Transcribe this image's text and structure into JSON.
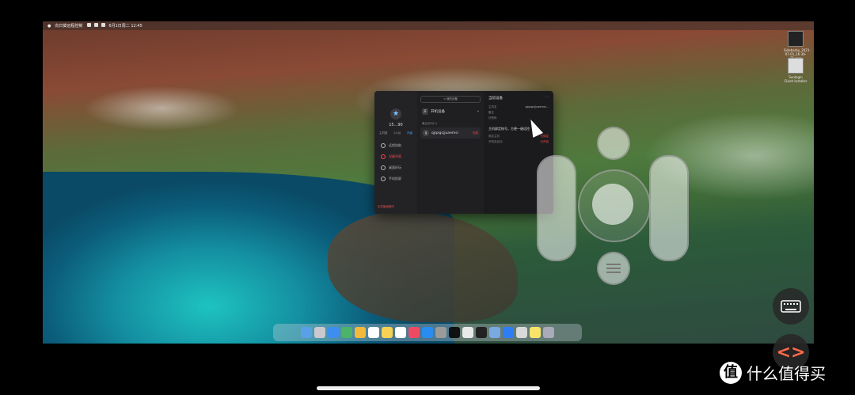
{
  "menubar": {
    "app_name": "向日葵远程控制",
    "right_text": "6月1日周二 12:45"
  },
  "desktop_icons": [
    {
      "label": "Sidebarby_2021-07-01_16-36-31.png"
    },
    {
      "label": "Sunlogin Client Installer"
    }
  ],
  "window": {
    "sidebar": {
      "avatar_icon": "star-icon",
      "username": "15...90",
      "plan": "主机数",
      "plan_count": "1/1台",
      "upgrade": "升级",
      "items": [
        {
          "label": "远程协助",
          "icon": "link-icon",
          "active": false
        },
        {
          "label": "设备列表",
          "icon": "device-icon",
          "active": true
        },
        {
          "label": "桌面好玩",
          "icon": "sparkle-icon",
          "active": false
        },
        {
          "label": "手机投屏",
          "icon": "mirror-icon",
          "active": false
        }
      ],
      "footer": "正在被远程中"
    },
    "middle": {
      "back": "< 我的设备",
      "group_badge": "开",
      "group_label": "开机设备",
      "recent_label": "最近访问(1)",
      "device_initial": "q",
      "device_name": "qjqxgcjjuaemsi",
      "device_tag": "在线"
    },
    "details": {
      "title": "当前设备",
      "rows": [
        {
          "k": "主机名",
          "v": "qjqxgcjjuaemsi..."
        },
        {
          "k": "备注",
          "v": ""
        },
        {
          "k": "识别码",
          "v": ""
        }
      ],
      "tip": "主机绑定帐号，方便一键远控",
      "rows2": [
        {
          "k": "绑定主机",
          "v": "已绑定",
          "red": true
        },
        {
          "k": "开机自启动",
          "v": "已开启",
          "red": true
        }
      ]
    }
  },
  "dock": {
    "apps": [
      "finder",
      "launchpad",
      "mail",
      "maps",
      "photos",
      "calendar",
      "notes",
      "reminders",
      "music",
      "appstore",
      "settings",
      "qq",
      "chrome",
      "epic",
      "finder2",
      "sunlogin",
      "preview",
      "stickies",
      "trash"
    ]
  },
  "watermark": {
    "logo": "值",
    "text": "什么值得买"
  },
  "colors": {
    "accent": "#ff4a4a",
    "link": "#4aa3ff"
  }
}
